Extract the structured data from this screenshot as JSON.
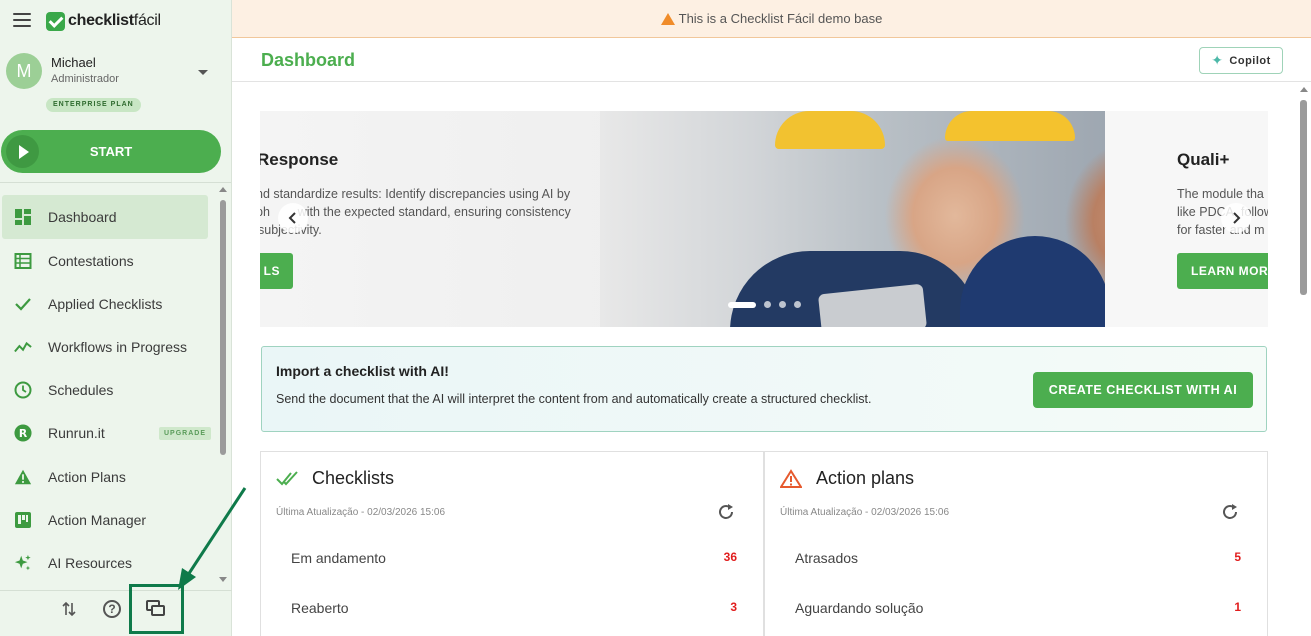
{
  "app": {
    "logo_bold": "checklist",
    "logo_light": "fácil"
  },
  "user": {
    "initial": "M",
    "name": "Michael",
    "role": "Administrador",
    "plan": "ENTERPRISE PLAN"
  },
  "start_label": "START",
  "nav": {
    "items": [
      {
        "label": "Dashboard",
        "icon": "dashboard-icon"
      },
      {
        "label": "Contestations",
        "icon": "table-list-icon"
      },
      {
        "label": "Applied Checklists",
        "icon": "check-icon"
      },
      {
        "label": "Workflows in Progress",
        "icon": "trending-icon"
      },
      {
        "label": "Schedules",
        "icon": "clock-icon"
      },
      {
        "label": "Runrun.it",
        "icon": "runrun-logo-icon",
        "badge": "UPGRADE"
      },
      {
        "label": "Action Plans",
        "icon": "warning-icon"
      },
      {
        "label": "Action Manager",
        "icon": "kanban-icon"
      },
      {
        "label": "AI Resources",
        "icon": "sparkle-icon"
      }
    ]
  },
  "banner": {
    "text": "This is a Checklist Fácil demo base",
    "color": "#f08c2a"
  },
  "header": {
    "title": "Dashboard",
    "copilot_label": "Copilot"
  },
  "carousel": {
    "left": {
      "title": "Response",
      "desc_lines": [
        "nd standardize results: Identify discrepancies using AI by",
        "ph        with the expected standard, ensuring consistency",
        "subjectivity."
      ],
      "button": "LS"
    },
    "right": {
      "title": "Quali+",
      "desc_lines": [
        "The module tha",
        "like PDCA, follow",
        "for faster and m"
      ],
      "button": "LEARN MORE"
    },
    "slide_count": 4,
    "active_slide": 1
  },
  "ai_import": {
    "title": "Import a checklist with AI!",
    "desc": "Send the document that the AI will interpret the content from and automatically create a structured checklist.",
    "button": "CREATE CHECKLIST WITH AI"
  },
  "cards": {
    "checklists": {
      "title": "Checklists",
      "updated": "Última Atualização - 02/03/2026 15:06",
      "rows": [
        {
          "label": "Em andamento",
          "value": "36"
        },
        {
          "label": "Reaberto",
          "value": "3"
        }
      ]
    },
    "action_plans": {
      "title": "Action plans",
      "updated": "Última Atualização - 02/03/2026 15:06",
      "rows": [
        {
          "label": "Atrasados",
          "value": "5"
        },
        {
          "label": "Aguardando solução",
          "value": "1"
        }
      ]
    }
  },
  "colors": {
    "brand_green": "#4cae4f",
    "alert_red": "#e11d1d",
    "annotation_green": "#0f7a4a"
  }
}
